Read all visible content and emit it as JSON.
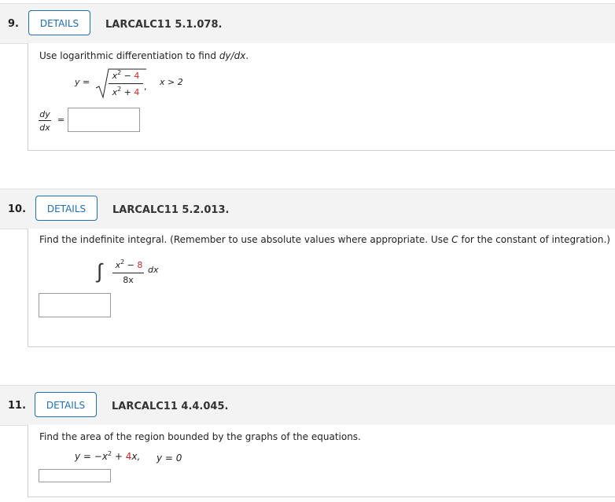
{
  "questions": [
    {
      "number": "9.",
      "details_label": "DETAILS",
      "code": "LARCALC11 5.1.078.",
      "prompt_pre": "Use logarithmic differentiation to find ",
      "prompt_var": "dy/dx",
      "prompt_post": ".",
      "eq_lhs": "y =",
      "num_var": "x",
      "num_exp": "2",
      "num_op": " − ",
      "num_const": "4",
      "den_var": "x",
      "den_exp": "2",
      "den_op": " + ",
      "den_const": "4",
      "comma": ",",
      "condition": "x > 2",
      "answer_lhs_num": "dy",
      "answer_lhs_den": "dx",
      "answer_eq": "=",
      "answer_value": ""
    },
    {
      "number": "10.",
      "details_label": "DETAILS",
      "code": "LARCALC11 5.2.013.",
      "prompt_pre": "Find the indefinite integral. (Remember to use absolute values where appropriate. Use ",
      "prompt_var": "C",
      "prompt_post": " for the constant of integration.)",
      "integral_sign": "∫",
      "num_var": "x",
      "num_exp": "2",
      "num_op": " − ",
      "num_const": "8",
      "den": "8x",
      "dx": "dx",
      "answer_value": ""
    },
    {
      "number": "11.",
      "details_label": "DETAILS",
      "code": "LARCALC11 4.4.045.",
      "prompt": "Find the area of the region bounded by the graphs of the equations.",
      "eq1_pre": "y = −x",
      "eq1_exp": "2",
      "eq1_op": " + ",
      "eq1_coef": "4",
      "eq1_var": "x,",
      "eq2": "y = 0",
      "answer_value": ""
    }
  ],
  "colors": {
    "accent": "#1f6fb2",
    "highlight_red": "#c22b2b",
    "header_bg": "#f3f3f3"
  }
}
